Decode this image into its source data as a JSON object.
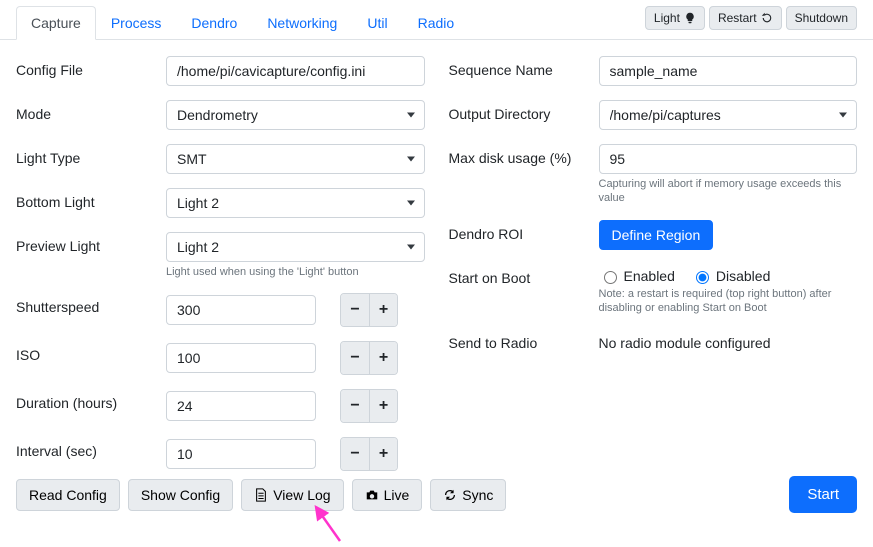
{
  "tabs": {
    "capture": "Capture",
    "process": "Process",
    "dendro": "Dendro",
    "networking": "Networking",
    "util": "Util",
    "radio": "Radio"
  },
  "top_actions": {
    "light": "Light",
    "restart": "Restart",
    "shutdown": "Shutdown"
  },
  "left": {
    "config_file": {
      "label": "Config File",
      "value": "/home/pi/cavicapture/config.ini"
    },
    "mode": {
      "label": "Mode",
      "value": "Dendrometry"
    },
    "light_type": {
      "label": "Light Type",
      "value": "SMT"
    },
    "bottom_light": {
      "label": "Bottom Light",
      "value": "Light 2"
    },
    "preview_light": {
      "label": "Preview Light",
      "value": "Light 2",
      "help": "Light used when using the 'Light' button"
    },
    "shutterspeed": {
      "label": "Shutterspeed",
      "value": "300"
    },
    "iso": {
      "label": "ISO",
      "value": "100"
    },
    "duration": {
      "label": "Duration (hours)",
      "value": "24"
    },
    "interval": {
      "label": "Interval (sec)",
      "value": "10"
    }
  },
  "right": {
    "sequence_name": {
      "label": "Sequence Name",
      "value": "sample_name"
    },
    "output_dir": {
      "label": "Output Directory",
      "value": "/home/pi/captures"
    },
    "max_disk": {
      "label": "Max disk usage (%)",
      "value": "95",
      "help": "Capturing will abort if memory usage exceeds this value"
    },
    "dendro_roi": {
      "label": "Dendro ROI",
      "button": "Define Region"
    },
    "start_on_boot": {
      "label": "Start on Boot",
      "enabled": "Enabled",
      "disabled": "Disabled",
      "help": "Note: a restart is required (top right button) after disabling or enabling Start on Boot"
    },
    "send_to_radio": {
      "label": "Send to Radio",
      "text": "No radio module configured"
    }
  },
  "bottom": {
    "read_config": "Read Config",
    "show_config": "Show Config",
    "view_log": "View Log",
    "live": "Live",
    "sync": "Sync",
    "start": "Start"
  },
  "stepper": {
    "minus": "−",
    "plus": "+"
  }
}
